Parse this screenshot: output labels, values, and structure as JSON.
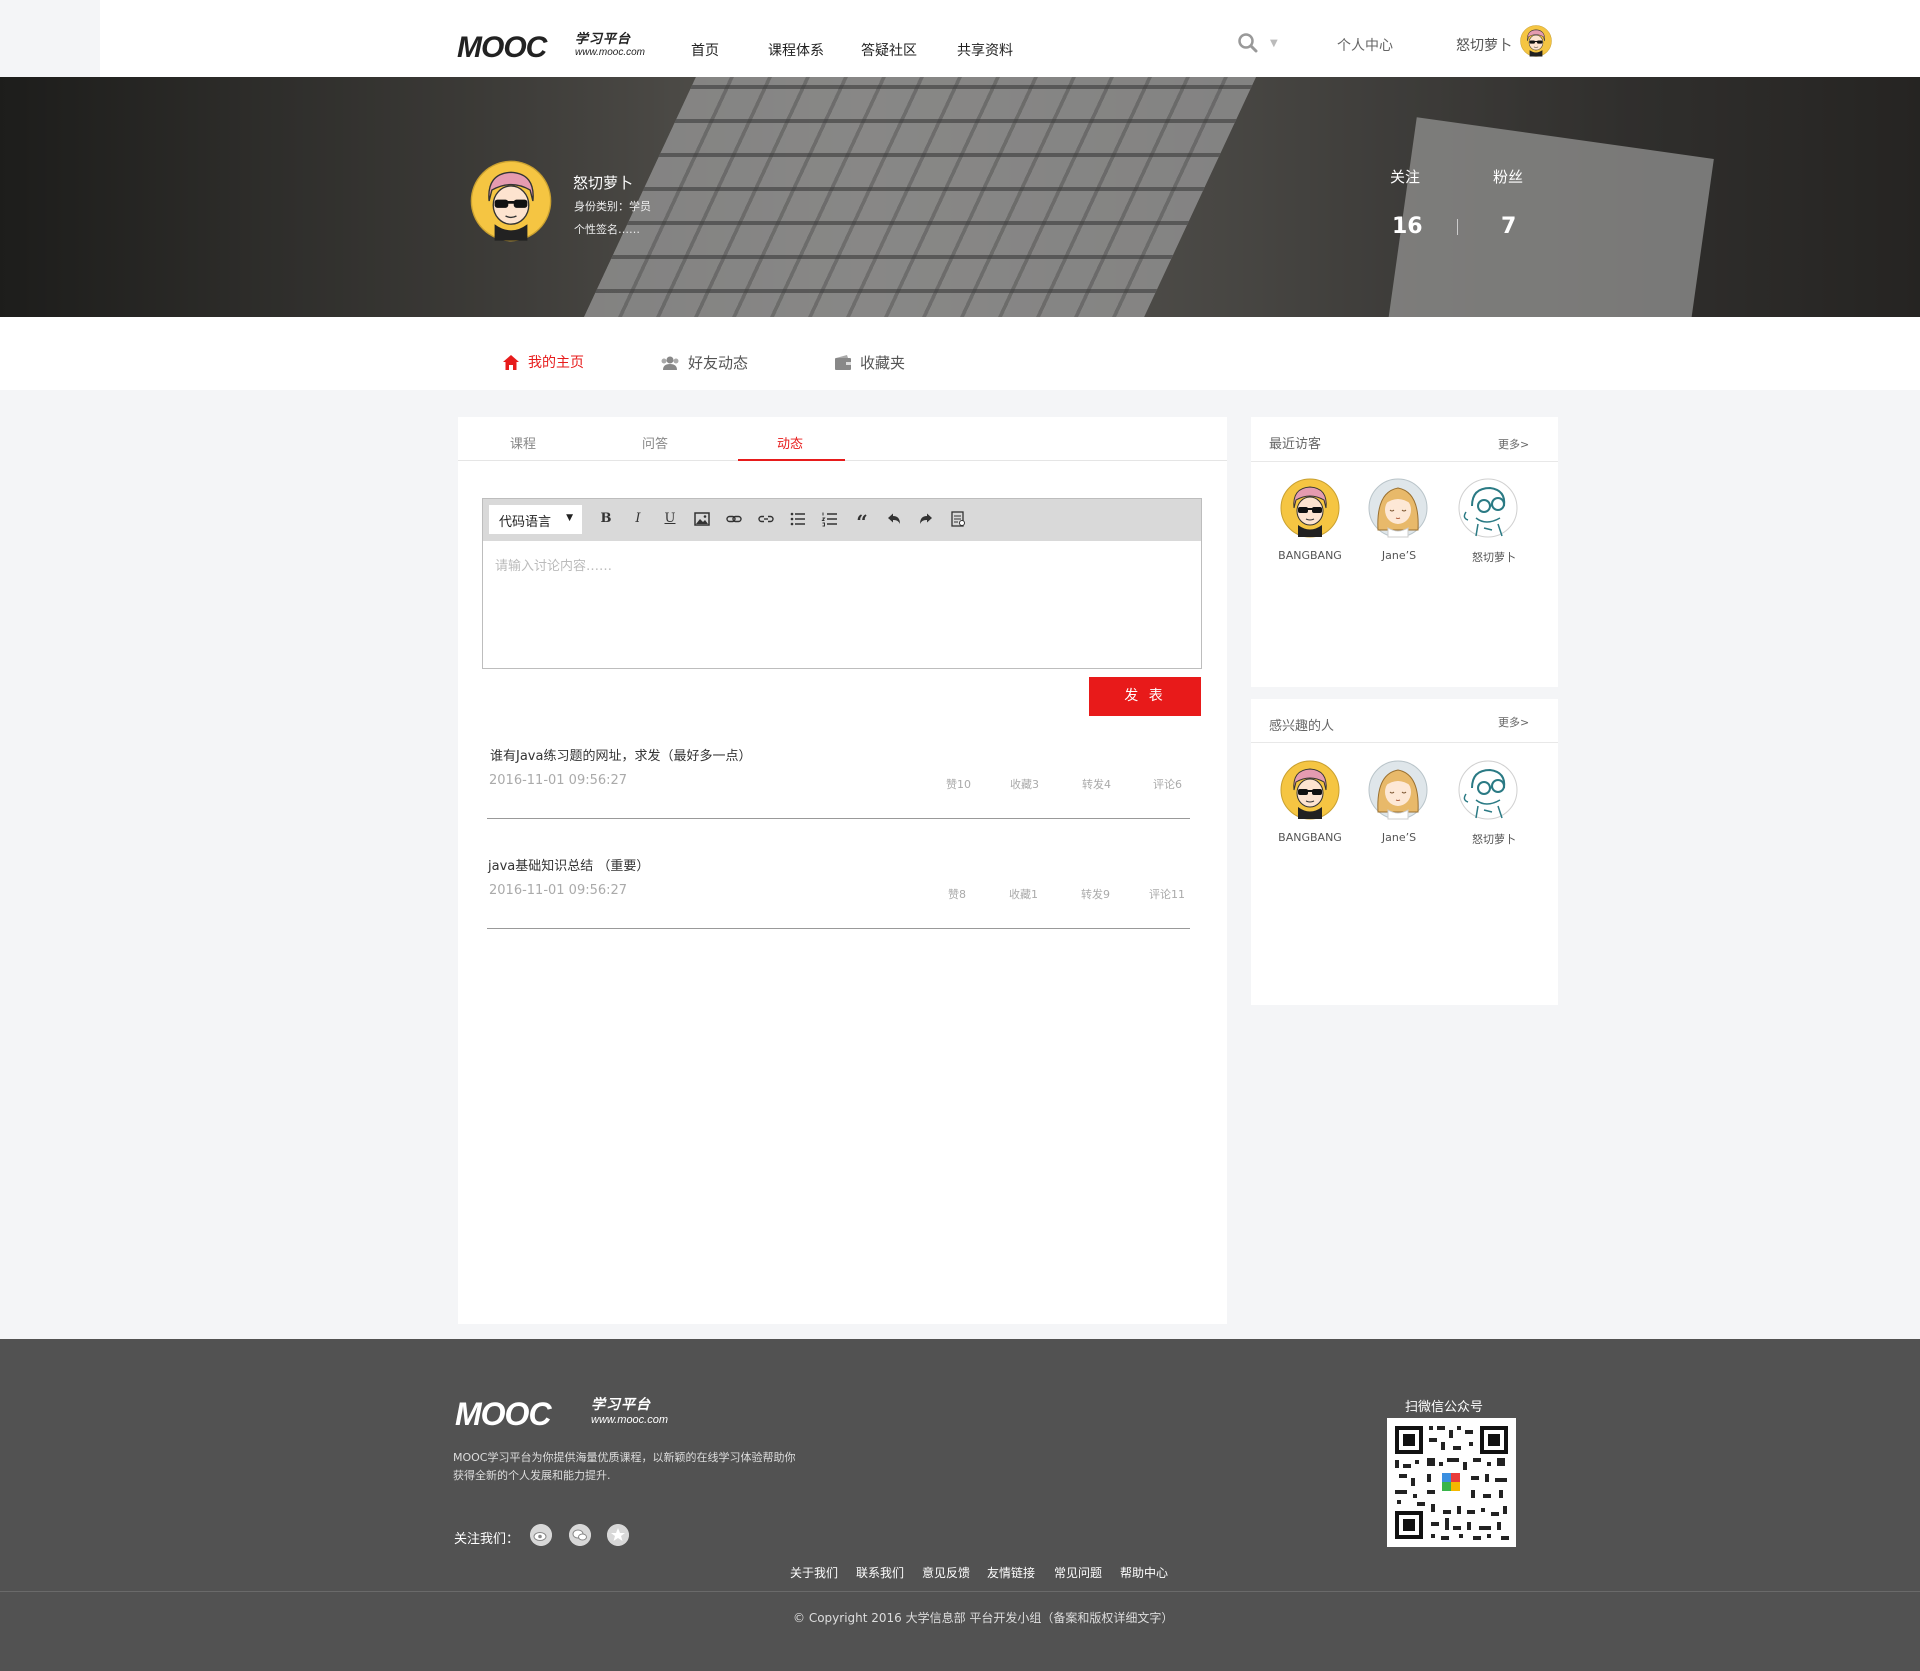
{
  "header": {
    "logo_text": "MOOC",
    "logo_cn": "学习平台",
    "logo_url": "www.mooc.com",
    "nav": [
      "首页",
      "课程体系",
      "答疑社区",
      "共享资料"
    ],
    "personal_center": "个人中心",
    "username": "怒切萝卜"
  },
  "profile": {
    "name": "怒切萝卜",
    "identity": "身份类别：学员",
    "signature": "个性签名……",
    "follow_label": "关注",
    "follow_count": "16",
    "fans_label": "粉丝",
    "fans_count": "7"
  },
  "tabs": [
    {
      "label": "我的主页",
      "icon": "home-icon"
    },
    {
      "label": "好友动态",
      "icon": "friends-icon"
    },
    {
      "label": "收藏夹",
      "icon": "wallet-icon"
    }
  ],
  "subtabs": [
    "课程",
    "问答",
    "动态"
  ],
  "editor": {
    "language_select": "代码语言",
    "placeholder": "请输入讨论内容……",
    "submit": "发 表",
    "toolbar": [
      "bold-icon",
      "italic-icon",
      "underline-icon",
      "image-icon",
      "link-icon",
      "unlink-icon",
      "bullet-list-icon",
      "numbered-list-icon",
      "quote-icon",
      "undo-icon",
      "redo-icon",
      "code-icon"
    ]
  },
  "posts": [
    {
      "title": "谁有Java练习题的网址，求发（最好多一点）",
      "date": "2016-11-01 09:56:27",
      "likes": "赞10",
      "favorites": "收藏3",
      "shares": "转发4",
      "comments": "评论6"
    },
    {
      "title": "java基础知识总结 （重要）",
      "date": "2016-11-01 09:56:27",
      "likes": "赞8",
      "favorites": "收藏1",
      "shares": "转发9",
      "comments": "评论11"
    }
  ],
  "visitors": {
    "title": "最近访客",
    "more": "更多>",
    "users": [
      "BANGBANG",
      "Jane’S",
      "怒切萝卜"
    ]
  },
  "interested": {
    "title": "感兴趣的人",
    "more": "更多>",
    "users": [
      "BANGBANG",
      "Jane’S",
      "怒切萝卜"
    ]
  },
  "footer": {
    "logo_text": "MOOC",
    "logo_cn": "学习平台",
    "logo_url": "www.mooc.com",
    "desc_line1": "MOOC学习平台为你提供海量优质课程，以新颖的在线学习体验帮助你",
    "desc_line2": "获得全新的个人发展和能力提升.",
    "follow_us": "关注我们：",
    "qr_label": "扫微信公众号",
    "links": [
      "关于我们",
      "联系我们",
      "意见反馈",
      "友情链接",
      "常见问题",
      "帮助中心"
    ],
    "copyright": "© Copyright 2016 大学信息部 平台开发小组（备案和版权详细文字）"
  },
  "colors": {
    "accent": "#e71b1b",
    "footer_bg": "#525252",
    "page_bg": "#f4f5f7"
  }
}
